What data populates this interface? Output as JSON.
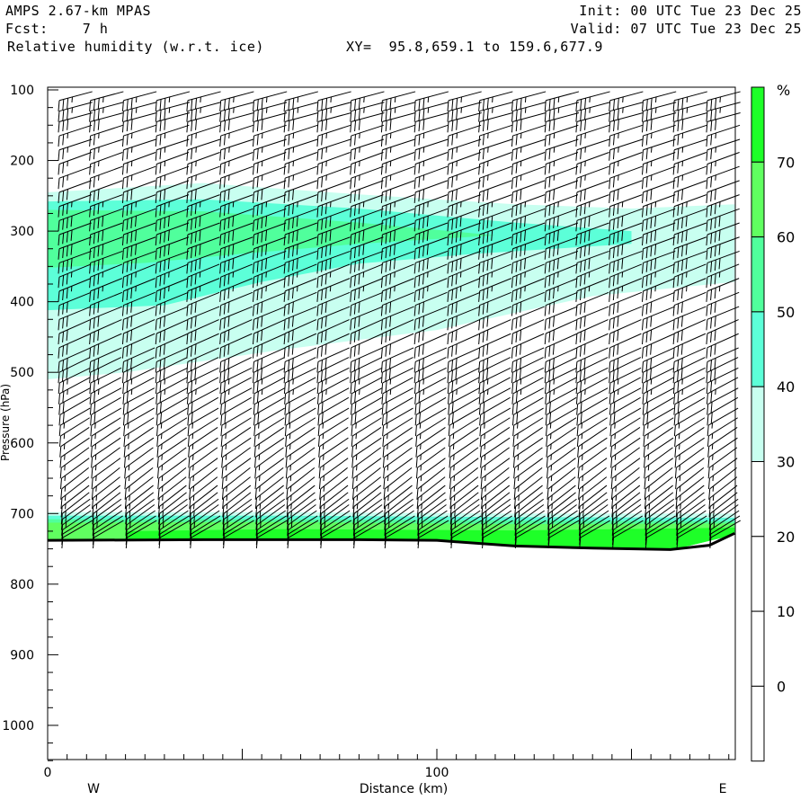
{
  "header": {
    "model": "AMPS 2.67-km MPAS",
    "forecast": "Fcst:    7 h",
    "field": "Relative humidity (w.r.t. ice)",
    "xy": "XY=  95.8,659.1 to 159.6,677.9",
    "init": "Init: 00 UTC Tue 23 Dec 25",
    "valid": "Valid: 07 UTC Tue 23 Dec 25"
  },
  "chart_data": {
    "type": "heatmap",
    "title": "Relative humidity (w.r.t. ice)",
    "xlabel": "Distance (km)",
    "ylabel": "Pressure (hPa)",
    "xlim": [
      0,
      176.5
    ],
    "ylim": [
      1050,
      100
    ],
    "x_ticks": [
      0,
      100
    ],
    "y_ticks": [
      100,
      200,
      300,
      400,
      500,
      600,
      700,
      800,
      900,
      1000
    ],
    "x_end_labels": {
      "left": "W",
      "right": "E"
    },
    "colorbar": {
      "unit": "%",
      "levels": [
        0,
        10,
        20,
        30,
        40,
        50,
        60,
        70
      ],
      "bands": [
        {
          "min": 30,
          "max": 40,
          "color": "#c8fff0"
        },
        {
          "min": 40,
          "max": 50,
          "color": "#5cffd8"
        },
        {
          "min": 50,
          "max": 60,
          "color": "#50ff9c"
        },
        {
          "min": 60,
          "max": 70,
          "color": "#60ff60"
        },
        {
          "min": 70,
          "max": 100,
          "color": "#1eff28"
        }
      ]
    },
    "regions": [
      {
        "band": 0,
        "points": [
          [
            0,
            245
          ],
          [
            40,
            232
          ],
          [
            80,
            248
          ],
          [
            120,
            262
          ],
          [
            150,
            268
          ],
          [
            176.5,
            262
          ],
          [
            176.5,
            372
          ],
          [
            140,
            392
          ],
          [
            100,
            440
          ],
          [
            60,
            468
          ],
          [
            20,
            500
          ],
          [
            0,
            510
          ]
        ]
      },
      {
        "band": 1,
        "points": [
          [
            0,
            258
          ],
          [
            40,
            255
          ],
          [
            80,
            268
          ],
          [
            120,
            288
          ],
          [
            150,
            300
          ],
          [
            150,
            318
          ],
          [
            110,
            332
          ],
          [
            80,
            346
          ],
          [
            55,
            372
          ],
          [
            30,
            405
          ],
          [
            0,
            412
          ]
        ]
      },
      {
        "band": 2,
        "points": [
          [
            0,
            270
          ],
          [
            40,
            272
          ],
          [
            80,
            288
          ],
          [
            115,
            306
          ],
          [
            80,
            318
          ],
          [
            50,
            332
          ],
          [
            25,
            345
          ],
          [
            0,
            352
          ]
        ]
      },
      {
        "band": 0,
        "points": [
          [
            0,
            698
          ],
          [
            60,
            698
          ],
          [
            120,
            700
          ],
          [
            176.5,
            700
          ],
          [
            176.5,
            730
          ],
          [
            160,
            752
          ],
          [
            120,
            750
          ],
          [
            60,
            738
          ],
          [
            0,
            738
          ]
        ]
      },
      {
        "band": 1,
        "points": [
          [
            0,
            703
          ],
          [
            60,
            703
          ],
          [
            120,
            705
          ],
          [
            176.5,
            706
          ],
          [
            176.5,
            730
          ],
          [
            160,
            752
          ],
          [
            120,
            750
          ],
          [
            60,
            738
          ],
          [
            0,
            738
          ]
        ]
      },
      {
        "band": 2,
        "points": [
          [
            0,
            708
          ],
          [
            60,
            708
          ],
          [
            120,
            710
          ],
          [
            176.5,
            711
          ],
          [
            176.5,
            730
          ],
          [
            160,
            752
          ],
          [
            120,
            750
          ],
          [
            60,
            738
          ],
          [
            0,
            738
          ]
        ]
      },
      {
        "band": 3,
        "points": [
          [
            0,
            713
          ],
          [
            60,
            712
          ],
          [
            120,
            715
          ],
          [
            176.5,
            714
          ],
          [
            176.5,
            730
          ],
          [
            160,
            752
          ],
          [
            120,
            750
          ],
          [
            60,
            738
          ],
          [
            0,
            738
          ]
        ]
      },
      {
        "band": 4,
        "points": [
          [
            20,
            725
          ],
          [
            60,
            722
          ],
          [
            120,
            724
          ],
          [
            176.5,
            720
          ],
          [
            176.5,
            730
          ],
          [
            160,
            752
          ],
          [
            120,
            750
          ],
          [
            60,
            738
          ],
          [
            20,
            738
          ]
        ]
      }
    ],
    "terrain": [
      [
        0,
        738
      ],
      [
        40,
        737
      ],
      [
        80,
        737
      ],
      [
        100,
        738
      ],
      [
        120,
        746
      ],
      [
        140,
        749
      ],
      [
        160,
        751
      ],
      [
        170,
        745
      ],
      [
        176.5,
        728
      ]
    ],
    "wind_barbs": {
      "columns_km": [
        3,
        11,
        19.5,
        28,
        36,
        44.5,
        53,
        61,
        69.5,
        78,
        86,
        94.5,
        103,
        111,
        119.5,
        128,
        136,
        144.5,
        153,
        161,
        169.5
      ],
      "levels": [
        {
          "p": 115,
          "kt": 35,
          "dir": 15
        },
        {
          "p": 130,
          "kt": 35,
          "dir": 15
        },
        {
          "p": 145,
          "kt": 30,
          "dir": 15
        },
        {
          "p": 165,
          "kt": 25,
          "dir": 18
        },
        {
          "p": 185,
          "kt": 25,
          "dir": 18
        },
        {
          "p": 205,
          "kt": 25,
          "dir": 20
        },
        {
          "p": 225,
          "kt": 25,
          "dir": 20
        },
        {
          "p": 245,
          "kt": 30,
          "dir": 20
        },
        {
          "p": 265,
          "kt": 35,
          "dir": 20
        },
        {
          "p": 285,
          "kt": 40,
          "dir": 20
        },
        {
          "p": 305,
          "kt": 40,
          "dir": 20
        },
        {
          "p": 325,
          "kt": 40,
          "dir": 20
        },
        {
          "p": 345,
          "kt": 40,
          "dir": 20
        },
        {
          "p": 365,
          "kt": 35,
          "dir": 22
        },
        {
          "p": 385,
          "kt": 35,
          "dir": 22
        },
        {
          "p": 405,
          "kt": 30,
          "dir": 22
        },
        {
          "p": 425,
          "kt": 30,
          "dir": 22
        },
        {
          "p": 445,
          "kt": 30,
          "dir": 24
        },
        {
          "p": 465,
          "kt": 30,
          "dir": 24
        },
        {
          "p": 485,
          "kt": 30,
          "dir": 24
        },
        {
          "p": 500,
          "kt": 30,
          "dir": 26
        },
        {
          "p": 515,
          "kt": 25,
          "dir": 26
        },
        {
          "p": 530,
          "kt": 25,
          "dir": 28
        },
        {
          "p": 545,
          "kt": 20,
          "dir": 28
        },
        {
          "p": 560,
          "kt": 20,
          "dir": 30
        },
        {
          "p": 575,
          "kt": 15,
          "dir": 30
        },
        {
          "p": 590,
          "kt": 15,
          "dir": 32
        },
        {
          "p": 605,
          "kt": 15,
          "dir": 34
        },
        {
          "p": 620,
          "kt": 15,
          "dir": 34
        },
        {
          "p": 635,
          "kt": 15,
          "dir": 36
        },
        {
          "p": 650,
          "kt": 15,
          "dir": 36
        },
        {
          "p": 665,
          "kt": 15,
          "dir": 38
        },
        {
          "p": 678,
          "kt": 15,
          "dir": 38
        },
        {
          "p": 690,
          "kt": 15,
          "dir": 38
        },
        {
          "p": 700,
          "kt": 15,
          "dir": 38
        },
        {
          "p": 708,
          "kt": 15,
          "dir": 36
        },
        {
          "p": 716,
          "kt": 15,
          "dir": 36
        },
        {
          "p": 723,
          "kt": 10,
          "dir": 34
        },
        {
          "p": 729,
          "kt": 10,
          "dir": 32
        },
        {
          "p": 734,
          "kt": 10,
          "dir": 30
        }
      ]
    }
  }
}
